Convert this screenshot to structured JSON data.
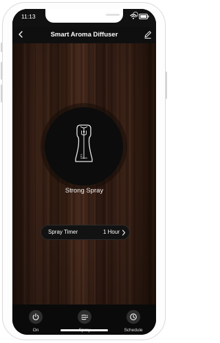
{
  "status_bar": {
    "time": "11:13"
  },
  "header": {
    "title": "Smart Aroma Diffuser",
    "back_icon": "chevron-left-icon",
    "edit_icon": "pencil-icon"
  },
  "device": {
    "icon": "diffuser-icon",
    "mode": "Strong Spray"
  },
  "timer": {
    "label": "Spray Timer",
    "value": "1 Hour"
  },
  "bottom_bar": {
    "on": {
      "label": "On",
      "icon": "power-icon"
    },
    "spray": {
      "label": "Spray",
      "icon": "spray-icon"
    },
    "schedule": {
      "label": "Schedule",
      "icon": "clock-icon"
    }
  },
  "colors": {
    "accent": "#ffffff",
    "bar": "#0a0a0a",
    "wood": "#3b2217"
  }
}
